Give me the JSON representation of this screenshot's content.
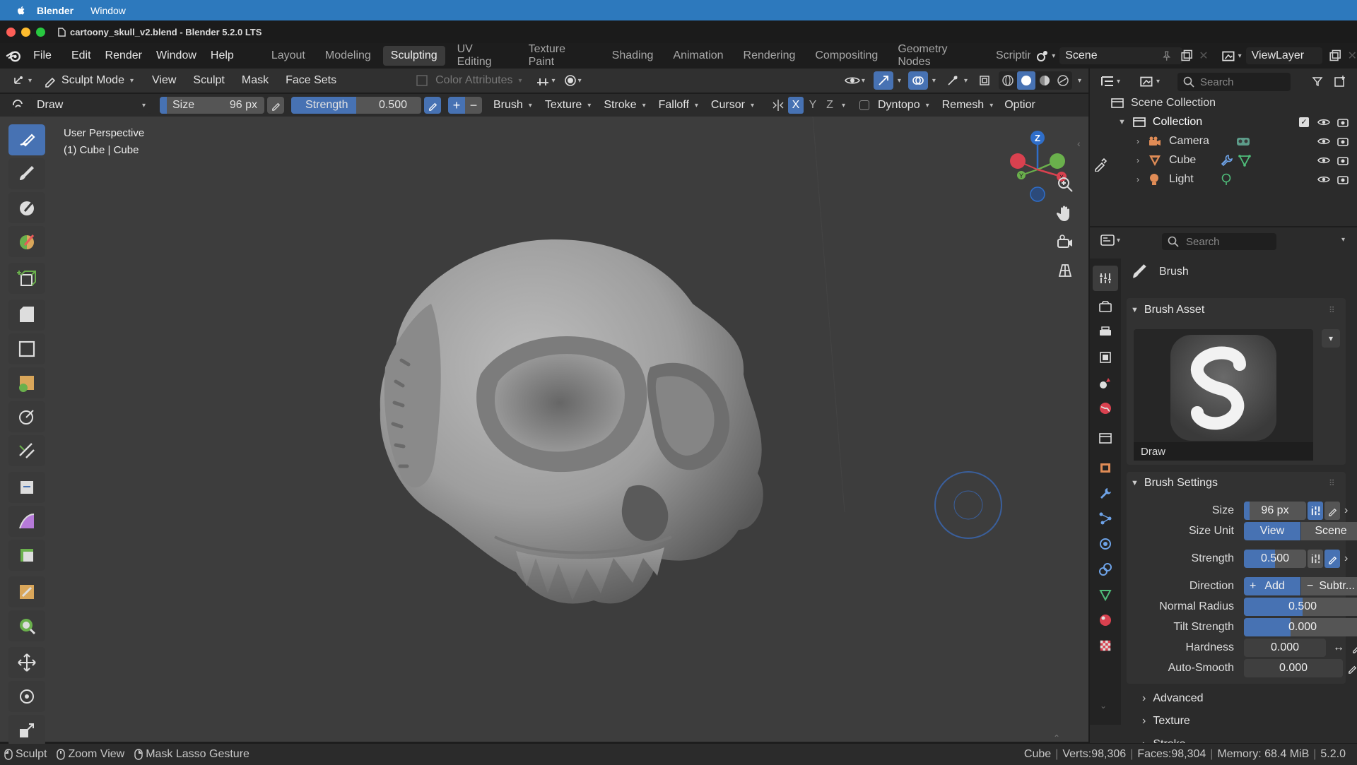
{
  "mac": {
    "app": "Blender",
    "menu_window": "Window"
  },
  "window": {
    "title": "cartoony_skull_v2.blend - Blender 5.2.0 LTS"
  },
  "menus": [
    "File",
    "Edit",
    "Render",
    "Window",
    "Help"
  ],
  "workspaces": [
    "Layout",
    "Modeling",
    "Sculpting",
    "UV Editing",
    "Texture Paint",
    "Shading",
    "Animation",
    "Rendering",
    "Compositing",
    "Geometry Nodes",
    "Scriptin"
  ],
  "active_workspace": "Sculpting",
  "scene": "Scene",
  "view_layer": "ViewLayer",
  "header": {
    "mode": "Sculpt Mode",
    "menus": [
      "View",
      "Sculpt",
      "Mask",
      "Face Sets"
    ],
    "color_attributes": "Color Attributes"
  },
  "tool_settings": {
    "brush": "Draw",
    "size_label": "Size",
    "size_value": "96 px",
    "strength_label": "Strength",
    "strength_value": "0.500",
    "plus": "+",
    "minus": "−",
    "menus": [
      "Brush",
      "Texture",
      "Stroke",
      "Falloff",
      "Cursor"
    ],
    "axes": [
      "X",
      "Y",
      "Z"
    ],
    "dyntopo": "Dyntopo",
    "remesh": "Remesh",
    "options": "Optior"
  },
  "viewport": {
    "perspective": "User Perspective",
    "object_info": "(1) Cube | Cube",
    "gizmo": {
      "z": "Z",
      "y": "Y",
      "x": "X"
    }
  },
  "outliner": {
    "search_placeholder": "Search",
    "scene_collection": "Scene Collection",
    "collection": "Collection",
    "items": [
      "Camera",
      "Cube",
      "Light"
    ]
  },
  "properties": {
    "search_placeholder": "Search",
    "tab_title": "Brush",
    "brush_asset_header": "Brush Asset",
    "brush_asset_name": "Draw",
    "brush_settings_header": "Brush Settings",
    "size_label": "Size",
    "size_value": "96 px",
    "size_unit_label": "Size Unit",
    "size_unit_view": "View",
    "size_unit_scene": "Scene",
    "strength_label": "Strength",
    "strength_value": "0.500",
    "direction_label": "Direction",
    "direction_add": "Add",
    "direction_sub": "Subtr...",
    "normal_radius_label": "Normal Radius",
    "normal_radius_value": "0.500",
    "normal_radius_fraction": 0.5,
    "tilt_strength_label": "Tilt Strength",
    "tilt_strength_value": "0.000",
    "hardness_label": "Hardness",
    "hardness_value": "0.000",
    "auto_smooth_label": "Auto-Smooth",
    "auto_smooth_value": "0.000",
    "advanced": "Advanced",
    "texture": "Texture",
    "stroke": "Stroke"
  },
  "status": {
    "sculpt": "Sculpt",
    "zoom": "Zoom View",
    "mask": "Mask Lasso Gesture",
    "object": "Cube",
    "verts": "Verts:98,306",
    "faces": "Faces:98,304",
    "memory": "Memory: 68.4 MiB",
    "version": "5.2.0"
  },
  "colors": {
    "accent": "#4772b3",
    "macbar": "#2d79bd",
    "viewport": "#3d3d3d"
  }
}
